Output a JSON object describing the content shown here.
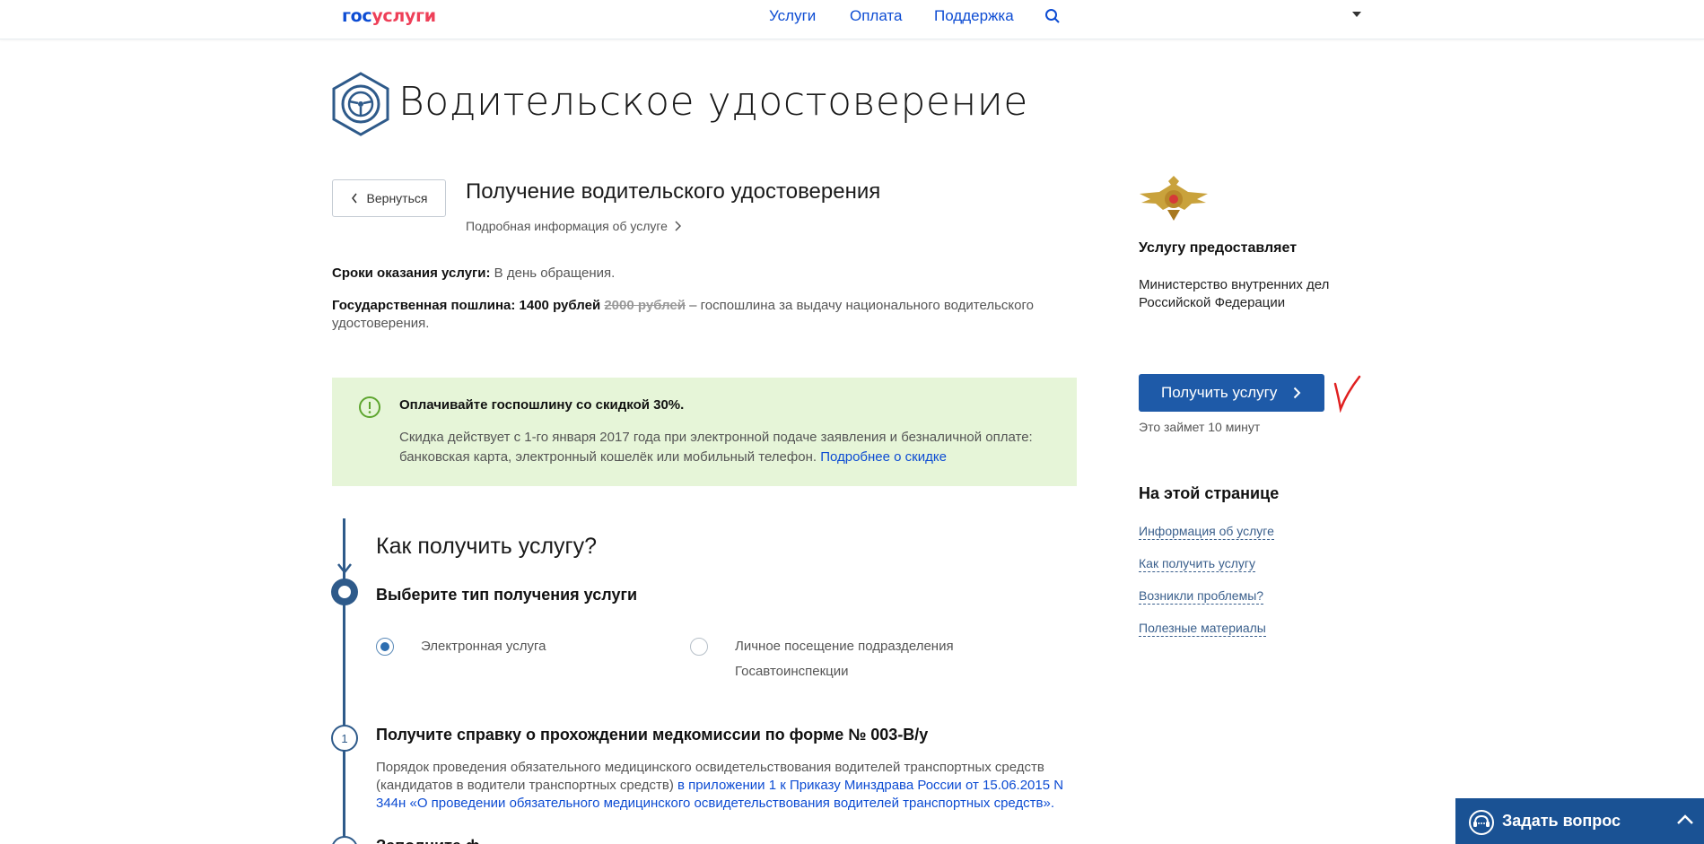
{
  "header": {
    "logo_part1": "гос",
    "logo_part2": "услуги",
    "nav": [
      "Услуги",
      "Оплата",
      "Поддержка"
    ],
    "colors": {
      "brand_blue": "#0d4cd3",
      "brand_red": "#ee3f58"
    }
  },
  "page": {
    "title": "Водительское удостоверение",
    "back_label": "Вернуться",
    "service_title": "Получение водительского удостоверения",
    "service_info_link": "Подробная информация об услуге",
    "terms_label": "Сроки оказания услуги:",
    "terms_value": "В день обращения.",
    "fee_label": "Государственная пошлина: 1400 рублей",
    "fee_old": "2000 рублей",
    "fee_desc": "– госпошлина за выдачу национального водительского удостоверения."
  },
  "discount": {
    "title": "Оплачивайте госпошлину со скидкой 30%.",
    "text": "Скидка действует с 1-го января 2017 года при электронной подаче заявления и безналичной оплате: банковская карта, электронный кошелёк или мобильный телефон.",
    "link": "Подробнее о скидке",
    "bg_color": "#e6f5d8"
  },
  "steps": {
    "heading": "Как получить услугу?",
    "choose_title": "Выберите тип получения услуги",
    "options": [
      {
        "label": "Электронная услуга",
        "selected": true
      },
      {
        "label": "Личное посещение подразделения Госавтоинспекции",
        "selected": false
      }
    ],
    "step1_number": "1",
    "step1_title": "Получите справку о прохождении медкомиссии по форме № 003-В/у",
    "step1_text": "Порядок проведения обязательного медицинского освидетельствования водителей транспортных средств (кандидатов в водители транспортных средств)",
    "step1_link": "в приложении 1 к Приказу Минздрава России от 15.06.2015 N 344н «О проведении обязательного медицинского освидетельствования водителей транспортных средств».",
    "step2_title": "Заполните ф"
  },
  "sidebar": {
    "provider_title": "Услугу предоставляет",
    "provider_name": "Министерство внутренних дел Российской Федерации",
    "get_button": "Получить услугу",
    "takes_time": "Это займет 10 минут",
    "on_page_title": "На этой странице",
    "links": [
      "Информация об услуге",
      "Как получить услугу",
      "Возникли проблемы?",
      "Полезные материалы"
    ]
  },
  "ask_widget": {
    "label": "Задать вопрос",
    "bg_color": "#1a5294"
  }
}
